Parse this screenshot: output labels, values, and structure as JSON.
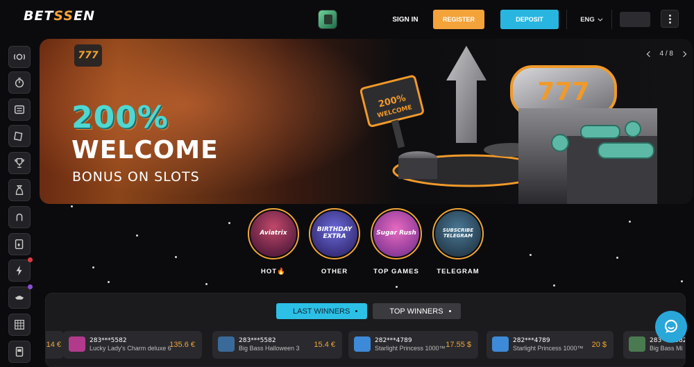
{
  "header": {
    "logo_text_a": "BET",
    "logo_text_b": "SS",
    "logo_text_c": "EN",
    "signin_label": "SIGN IN",
    "register_label": "REGISTER",
    "deposit_label": "DEPOSIT",
    "language": "ENG"
  },
  "sidebar": {
    "items": [
      {
        "icon": "sports-ball-icon"
      },
      {
        "icon": "stopwatch-icon"
      },
      {
        "icon": "slot-machine-icon"
      },
      {
        "icon": "ticket-icon"
      },
      {
        "icon": "trophy-icon"
      },
      {
        "icon": "money-bag-icon"
      },
      {
        "icon": "horseshoe-icon"
      },
      {
        "icon": "cards-icon"
      },
      {
        "icon": "lightning-icon",
        "badge_color": "#e2383f"
      },
      {
        "icon": "bull-icon",
        "badge_color": "#8a4ed6"
      },
      {
        "icon": "keno-grid-icon"
      },
      {
        "icon": "game-cabinet-icon"
      }
    ]
  },
  "banner": {
    "badge": "777",
    "headline": "200%",
    "subheadline": "WELCOME",
    "tagline": "BONUS ON SLOTS",
    "pager": "4 / 8"
  },
  "categories": [
    {
      "label": "HOT🔥",
      "art_text": "Aviatrix",
      "bg": "#7a2b50"
    },
    {
      "label": "OTHER",
      "art_text": "BIRTHDAY EXTRA",
      "bg": "#4a3aa0"
    },
    {
      "label": "TOP GAMES",
      "art_text": "Sugar Rush",
      "bg": "#c04aa8"
    },
    {
      "label": "TELEGRAM",
      "art_text": "SUBSCRIBE TELEGRAM",
      "bg": "#2f4e63"
    }
  ],
  "winners": {
    "tab_last": "LAST WINNERS",
    "tab_top": "TOP WINNERS",
    "partial_left_amount": "14 €",
    "cards": [
      {
        "user": "283***5582",
        "game": "Lucky Lady's Charm deluxe 6",
        "amount": "135.6 €",
        "thumb": "#b23a8c"
      },
      {
        "user": "283***5582",
        "game": "Big Bass Halloween 3",
        "amount": "15.4 €",
        "thumb": "#3a6a9a"
      },
      {
        "user": "282***4789",
        "game": "Starlight Princess 1000™",
        "amount": "17.55 $",
        "thumb": "#3d8ad8"
      },
      {
        "user": "282***4789",
        "game": "Starlight Princess 1000™",
        "amount": "20 $",
        "thumb": "#3d8ad8"
      },
      {
        "user": "283***5582",
        "game": "Big Bass Mi",
        "amount": "",
        "thumb": "#4a7a50"
      }
    ]
  }
}
